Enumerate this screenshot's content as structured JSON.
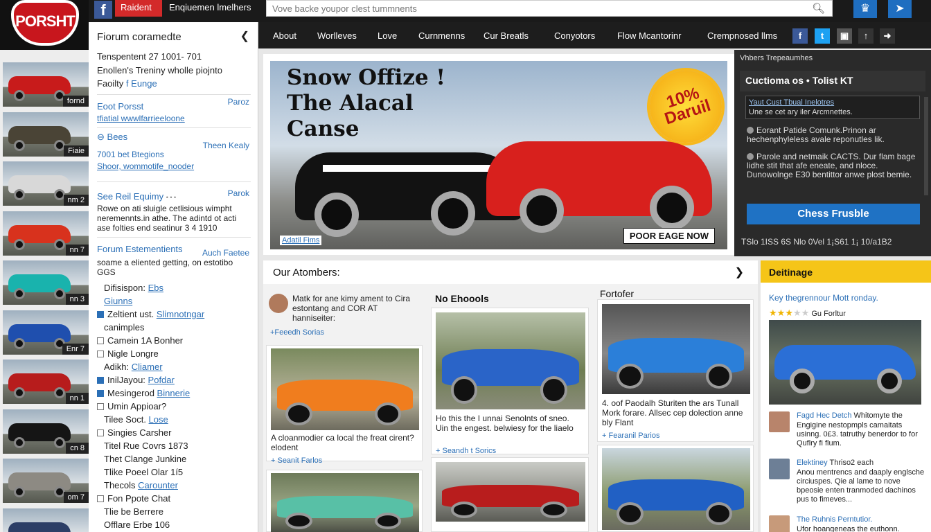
{
  "logo": {
    "text": "PORSHT"
  },
  "topbar": {
    "facebook_icon": "f",
    "red_button": "Raident",
    "members_link": "Enqiuemen lmelhers",
    "search_placeholder": "Vove backe youpor clest tummnents",
    "icons": [
      "trophy-icon",
      "send-icon"
    ]
  },
  "nav": {
    "items": [
      "About",
      "Worlleves",
      "Love",
      "Curnmenns",
      "Cur Breatls",
      "Conyotors",
      "Flow Mcantorinr",
      "Crempnosed llms"
    ],
    "social": [
      "facebook-icon",
      "twitter-icon",
      "camera-icon",
      "share-icon",
      "forward-icon"
    ]
  },
  "thumbs": [
    {
      "tag": "fornd",
      "color": "#c81b1b"
    },
    {
      "tag": "Fiaie",
      "color": "#4a4436"
    },
    {
      "tag": "nm 2",
      "color": "#d8d8d8"
    },
    {
      "tag": "nn 7",
      "color": "#d8321d"
    },
    {
      "tag": "nn 3",
      "color": "#19b3ad"
    },
    {
      "tag": "Enr 7",
      "color": "#1f4fae"
    },
    {
      "tag": "nn 1",
      "color": "#b71c1c"
    },
    {
      "tag": "cn 8",
      "color": "#151515"
    },
    {
      "tag": "om 7",
      "color": "#8d8a83"
    },
    {
      "tag": "",
      "color": "#2c3e66"
    }
  ],
  "forum": {
    "title": "Fiorum coramedte",
    "line1": "Tenspentent 27 1001- 701",
    "line2": "Enollen's Treniny wholle piojnto",
    "line3_a": "Faoilty",
    "line3_b": "f Eunge",
    "s1_title": "Eoot Porsst",
    "s1_right": "Paroz",
    "s1_link": "tfiatial wwwlfarrieeloone",
    "s2_title": "Bees",
    "s2_right": "Theen Kealy",
    "s2_line": "7001 bet Btegions",
    "s2_link": "Shoor, wommotife_nooder",
    "s3_title": "See Reil Equimy",
    "s3_title_small": "• • •",
    "s3_right": "Parok",
    "s3_desc1": "Rowe on ati sluigle cetlisious wimpht",
    "s3_desc2": "neremennts.in athe. The adintd ot acti",
    "s3_desc3": "ase folties end seatinur 3 4 1910",
    "s4_title": "Forum Estementients",
    "s4_right": "Auch Faetee",
    "s4_desc1": "soame a eliented getting, on estotibo",
    "s4_desc2": "GGS",
    "list": [
      {
        "check": "none",
        "text": "Difisispon: ",
        "link": "Ebs"
      },
      {
        "check": "none",
        "text": "",
        "link": "Giunns"
      },
      {
        "check": "on",
        "text": "Zeltient ust. ",
        "link": "Slimnotngar"
      },
      {
        "check": "none",
        "text": "canimples",
        "link": ""
      },
      {
        "check": "off",
        "text": "Camein 1A Bonher",
        "link": ""
      },
      {
        "check": "off",
        "text": "Nigle Longre",
        "link": ""
      },
      {
        "check": "none",
        "text": "Adikh: ",
        "link": "Cliamer"
      },
      {
        "check": "on",
        "text": "InilJayou: ",
        "link": "Pofdar"
      },
      {
        "check": "on",
        "text": "Mesingerod ",
        "link": "Binnerie"
      },
      {
        "check": "off",
        "text": "Umin Appioar?",
        "link": ""
      },
      {
        "check": "none",
        "text": "Tilee Soct. ",
        "link": "Lose"
      },
      {
        "check": "off",
        "text": "Singies Carsher",
        "link": ""
      },
      {
        "check": "none",
        "text": "Titel Rue Covrs 1873",
        "link": ""
      },
      {
        "check": "none",
        "text": "Thet Clange Junkine",
        "link": ""
      },
      {
        "check": "none",
        "text": "Tlike Poeel Olar 1í5",
        "link": ""
      },
      {
        "check": "none",
        "text": "Thecols ",
        "link": "Carounter"
      },
      {
        "check": "off",
        "text": "Fon Ppote Chat",
        "link": ""
      },
      {
        "check": "none",
        "text": "Tlie be Berrere",
        "link": ""
      },
      {
        "check": "none",
        "text": "Offlare Erbe 106",
        "link": ""
      }
    ]
  },
  "hero": {
    "title_lines": [
      "Snow Offize !",
      "The Alacal",
      "Canse"
    ],
    "badge_text": "10% Daruil",
    "caption": "Adatil Fims",
    "ribbon": "POOR EAGE NOW"
  },
  "right_panel": {
    "top": "Vhbers Trepeaumhes",
    "title": "Cuctioma os • Tolist KT",
    "box_link": "Yaut Cust Tbual Inelotres",
    "box_text": "Une se cet ary iler Arcmnettes.",
    "item1": "Eorant Patide Comunk.Prinon ar hechenphyleless avale reponutles lik.",
    "item2": "Parole and netmaik CACTS. Dur flam bage lidhe stit that afe eneate, and nloce. Dunowolnge E30 bentittor anwe plost bemie.",
    "cta": "Chess Frusble",
    "footer": "TSlo 1ISS 6S Nlo 0Vel 1¡S61 1¡ 10/a1B2"
  },
  "content": {
    "title": "Our Atombers:",
    "col2_title": "No Ehoools",
    "col3_title": "Fortofer",
    "card_intro": "Matk for ane kimy ament to Cira estontang and COR AT hanniseiter:",
    "card_intro_sub": "+Feeedh Sorias",
    "c1_text": "A cloanmodier ca local the freat cirent? elodent",
    "c1_sub": "+ Seanit Farlos",
    "c2_text": "Ho this the I unnai Senolnts of sneo. Uin the engest. belwiesy for the liaelo",
    "c2_sub": "+ Seandh t Sorics",
    "c3_text": "4. oof Paodalh Sturiten the ars Tunall Mork forare. Allsec cep dolection anne bly Flant",
    "c3_sub": "+ Fearanil Parios"
  },
  "sidebar": {
    "header": "Deitinage",
    "line1": "Key thegrennour Mott ronday.",
    "rating_text": "Gu Forltur",
    "rating": 3,
    "posts": [
      {
        "title": "Fagd Hec Detch",
        "rest": " Whitomyte the",
        "excerpt": "Engigine nestopmpls camaitats usinng. 0£3. tatruthy benerdor to for Quflry fi flum."
      },
      {
        "title": "Elektiney",
        "rest": " Thriso2 each",
        "excerpt": "Anou mentrencs and daaply englsche circiuspes. Qie al lame to nove bpeosie enten tranmoded dachinos pus to fimeves..."
      },
      {
        "title": "The Ruhnis Perntutior.",
        "rest": "",
        "excerpt": "Ufor hoangeneas the euthonn."
      }
    ]
  }
}
